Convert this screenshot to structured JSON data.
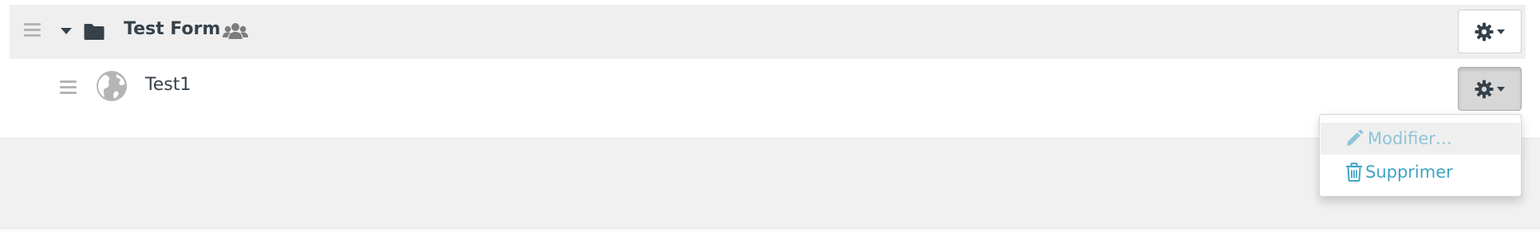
{
  "folder": {
    "title": "Test Form",
    "icons": {
      "drag": "drag-handle-icon",
      "toggle": "caret-down-icon",
      "folder": "folder-icon",
      "shared": "users-icon",
      "settings": "gear-icon"
    }
  },
  "item": {
    "title": "Test1",
    "icons": {
      "drag": "drag-handle-icon",
      "type": "globe-icon",
      "settings": "gear-icon"
    }
  },
  "menu": {
    "items": [
      {
        "label": "Modifier…",
        "icon": "pencil-icon"
      },
      {
        "label": "Supprimer",
        "icon": "trash-icon"
      }
    ]
  },
  "colors": {
    "text": "#36414a",
    "link": "#3fa5c4",
    "link_hover": "#8ec5d7",
    "folder_row_bg": "#efefef",
    "page_bg": "#f1f1f1"
  }
}
